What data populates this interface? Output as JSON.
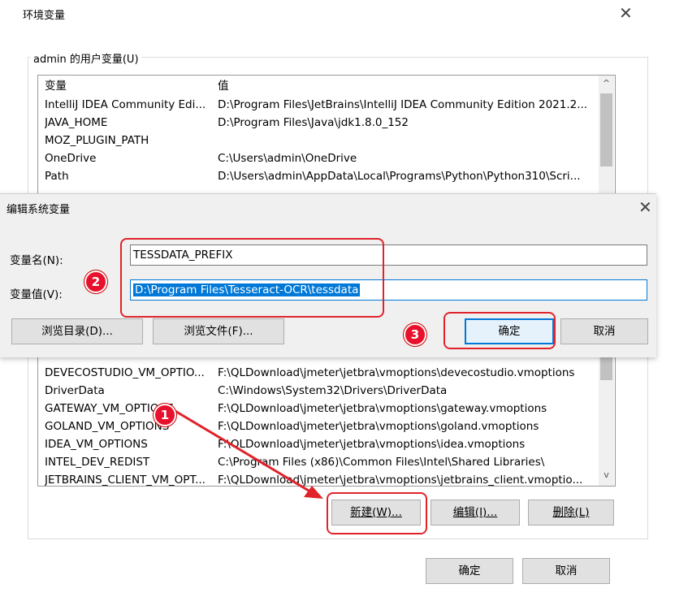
{
  "main_window": {
    "title": "环境变量",
    "close_glyph": "✕",
    "user_vars_group_label": "admin 的用户变量(U)",
    "columns": [
      "变量",
      "值"
    ],
    "user_rows": [
      {
        "name": "IntelliJ IDEA Community Edi...",
        "value": "D:\\Program Files\\JetBrains\\IntelliJ IDEA Community Edition 2021.2..."
      },
      {
        "name": "JAVA_HOME",
        "value": "D:\\Program Files\\Java\\jdk1.8.0_152"
      },
      {
        "name": "MOZ_PLUGIN_PATH",
        "value": ""
      },
      {
        "name": "OneDrive",
        "value": "C:\\Users\\admin\\OneDrive"
      },
      {
        "name": "Path",
        "value": "D:\\Users\\admin\\AppData\\Local\\Programs\\Python\\Python310\\Scri..."
      }
    ],
    "system_rows": [
      {
        "name": "DEVECOSTUDIO_VM_OPTIO...",
        "value": "F:\\QLDownload\\jmeter\\jetbra\\vmoptions\\devecostudio.vmoptions"
      },
      {
        "name": "DriverData",
        "value": "C:\\Windows\\System32\\Drivers\\DriverData"
      },
      {
        "name": "GATEWAY_VM_OPTIONS",
        "value": "F:\\QLDownload\\jmeter\\jetbra\\vmoptions\\gateway.vmoptions"
      },
      {
        "name": "GOLAND_VM_OPTIONS",
        "value": "F:\\QLDownload\\jmeter\\jetbra\\vmoptions\\goland.vmoptions"
      },
      {
        "name": "IDEA_VM_OPTIONS",
        "value": "F:\\QLDownload\\jmeter\\jetbra\\vmoptions\\idea.vmoptions"
      },
      {
        "name": "INTEL_DEV_REDIST",
        "value": "C:\\Program Files (x86)\\Common Files\\Intel\\Shared Libraries\\"
      },
      {
        "name": "JETBRAINS_CLIENT_VM_OPT...",
        "value": "F:\\QLDownload\\jmeter\\jetbra\\vmoptions\\jetbrains_client.vmoptio..."
      }
    ],
    "scroll_up": "^",
    "scroll_down": "v",
    "new_button": "新建(W)...",
    "edit_button": "编辑(I)...",
    "delete_button": "删除(L)",
    "ok_button": "确定",
    "cancel_button": "取消"
  },
  "edit_dialog": {
    "title": "编辑系统变量",
    "close_glyph": "✕",
    "name_label": "变量名(N):",
    "name_value": "TESSDATA_PREFIX",
    "value_label": "变量值(V):",
    "value_value": "D:\\Program Files\\Tesseract-OCR\\tessdata",
    "browse_dir_button": "浏览目录(D)...",
    "browse_file_button": "浏览文件(F)...",
    "ok_button": "确定",
    "cancel_button": "取消"
  },
  "annotations": {
    "badge_1": "1",
    "badge_2": "2",
    "badge_3": "3",
    "highlight_color": "#e0232a"
  }
}
